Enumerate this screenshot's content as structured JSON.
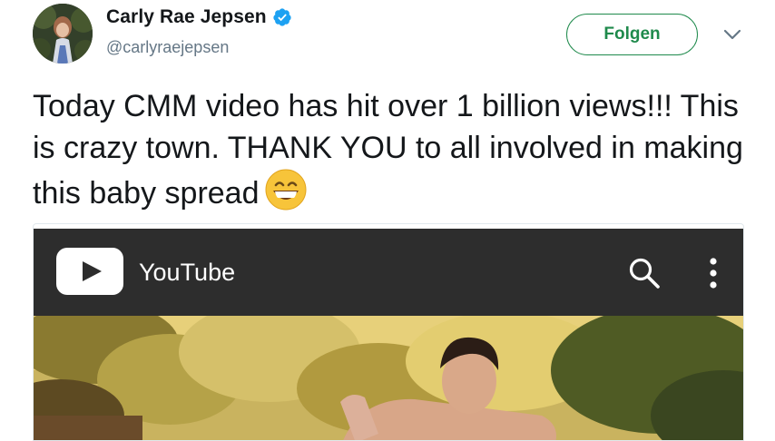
{
  "author": {
    "display_name": "Carly Rae Jepsen",
    "handle": "@carlyraejepsen",
    "verified_icon": "verified-badge-icon",
    "avatar": "avatar"
  },
  "actions": {
    "follow_label": "Folgen",
    "more_icon": "chevron-down-icon"
  },
  "tweet": {
    "text": "Today CMM video has hit over 1 billion views!!! This is crazy town. THANK YOU to all involved in making this baby spread",
    "emoji": "grinning-face-icon"
  },
  "media": {
    "app_name": "YouTube",
    "icons": [
      "youtube-logo-icon",
      "search-icon",
      "more-vertical-icon"
    ]
  },
  "colors": {
    "accent_green": "#1f8a4c",
    "verified_blue": "#1da1f2",
    "youtube_bar": "#2d2d2d",
    "handle_gray": "#657786"
  }
}
